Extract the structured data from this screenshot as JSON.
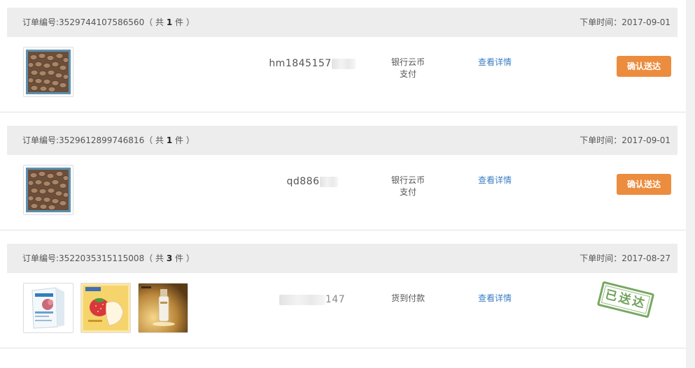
{
  "labels": {
    "order_no_prefix": "订单编号:",
    "count_open": "（ 共 ",
    "count_close": " 件 ）",
    "order_time_prefix": "下单时间：",
    "view_details": "查看详情",
    "confirm_delivery": "确认送达",
    "delivered_stamp": "已送达"
  },
  "colors": {
    "confirm_button": "#ec8c3e",
    "link": "#3b7fc4",
    "stamp": "#6a9e52",
    "header_bg": "#ededed"
  },
  "orders": [
    {
      "order_no": "3529744107586560",
      "item_count": "1",
      "order_time": "2017-09-01",
      "buyer_visible": "hm1845157",
      "payment_line1": "银行云币",
      "payment_line2": "支付",
      "action": "confirm",
      "products": [
        "peanut-product-image"
      ]
    },
    {
      "order_no": "3529612899746816",
      "item_count": "1",
      "order_time": "2017-09-01",
      "buyer_visible": "qd886",
      "payment_line1": "银行云币",
      "payment_line2": "支付",
      "action": "delivered-none",
      "products": [
        "peanut-product-image"
      ]
    },
    {
      "order_no": "3522035315115008",
      "item_count": "3",
      "order_time": "2017-08-27",
      "buyer_visible": "147",
      "payment_line1": "货到付款",
      "payment_line2": "",
      "action": "delivered",
      "products": [
        "skincare-box-image",
        "strawberry-mask-box-image",
        "serum-bottle-image"
      ]
    }
  ]
}
